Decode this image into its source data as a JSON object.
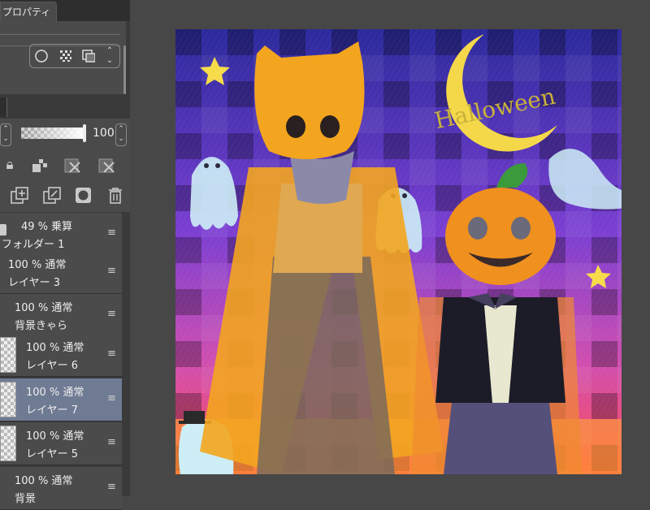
{
  "properties_panel": {
    "tab_label": "プロパティ"
  },
  "layer_panel": {
    "opacity_value": "100",
    "layers": [
      {
        "line1": "49 % 乗算",
        "line2": "フォルダー 1",
        "selected": false
      },
      {
        "line1": "100 % 通常",
        "line2": "レイヤー 3",
        "selected": false
      },
      {
        "line1": "100 % 通常",
        "line2": "背景きゃら",
        "selected": false
      },
      {
        "line1": "100 % 通常",
        "line2": "レイヤー 6",
        "selected": false
      },
      {
        "line1": "100 % 通常",
        "line2": "レイヤー 7",
        "selected": true
      },
      {
        "line1": "100 % 通常",
        "line2": "レイヤー 5",
        "selected": false
      },
      {
        "line1": "100 % 通常",
        "line2": "背景",
        "selected": false
      }
    ]
  },
  "canvas": {
    "moon_text": "Halloween",
    "colors": {
      "sky_top": "#2b2a9c",
      "sky_mid": "#8a3fd6",
      "sky_bottom": "#ff4d55",
      "moon": "#f4d84a",
      "cape": "#f3a51f",
      "pumpkin": "#f0901e",
      "ghost": "#cdeef6"
    }
  }
}
